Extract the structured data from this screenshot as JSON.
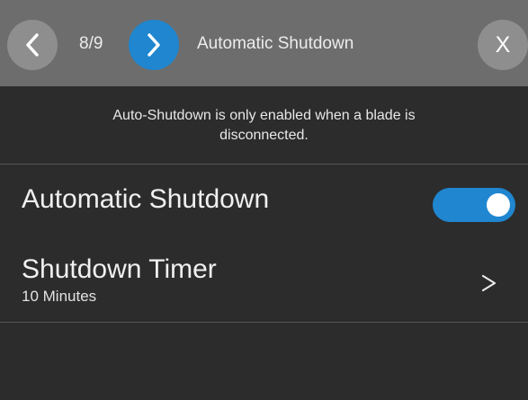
{
  "header": {
    "page_indicator": "8/9",
    "title": "Automatic Shutdown",
    "prev_icon": "chevron-left-icon",
    "next_icon": "chevron-right-icon",
    "close_label": "X"
  },
  "notice": {
    "line1": "Auto-Shutdown is only enabled when a blade is",
    "line2": "disconnected."
  },
  "settings": {
    "auto_shutdown": {
      "label": "Automatic Shutdown",
      "enabled": true
    },
    "shutdown_timer": {
      "label": "Shutdown Timer",
      "value": "10 Minutes"
    }
  },
  "colors": {
    "accent": "#1f86cf",
    "header_bg": "#6d6d6d",
    "body_bg": "#2c2c2c",
    "button_gray": "#8e8e8e"
  }
}
